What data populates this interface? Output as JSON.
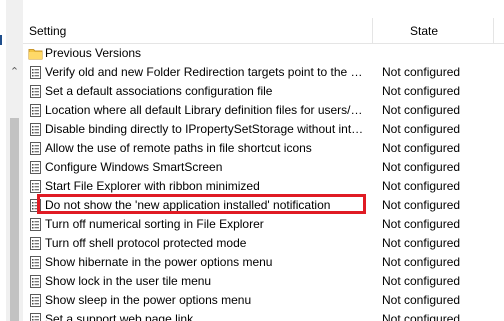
{
  "header": {
    "setting_label": "Setting",
    "state_label": "State"
  },
  "folder": {
    "label": "Previous Versions",
    "icon": "folder-icon"
  },
  "policies": [
    {
      "name": "Verify old and new Folder Redirection targets point to the sa...",
      "state": "Not configured"
    },
    {
      "name": "Set a default associations configuration file",
      "state": "Not configured"
    },
    {
      "name": "Location where all default Library definition files for users/m...",
      "state": "Not configured"
    },
    {
      "name": "Disable binding directly to IPropertySetStorage without inter...",
      "state": "Not configured"
    },
    {
      "name": "Allow the use of remote paths in file shortcut icons",
      "state": "Not configured"
    },
    {
      "name": "Configure Windows SmartScreen",
      "state": "Not configured"
    },
    {
      "name": "Start File Explorer with ribbon minimized",
      "state": "Not configured"
    },
    {
      "name": "Do not show the 'new application installed' notification",
      "state": "Not configured"
    },
    {
      "name": "Turn off numerical sorting in File Explorer",
      "state": "Not configured"
    },
    {
      "name": "Turn off shell protocol protected mode",
      "state": "Not configured"
    },
    {
      "name": "Show hibernate in the power options menu",
      "state": "Not configured"
    },
    {
      "name": "Show lock in the user tile menu",
      "state": "Not configured"
    },
    {
      "name": "Show sleep in the power options menu",
      "state": "Not configured"
    },
    {
      "name": "Set a support web page link",
      "state": "Not configured"
    }
  ],
  "policy_icon": "policy-setting-icon",
  "colors": {
    "highlight_border": "#e01b24",
    "scroll_track": "#f0f0f0",
    "scroll_thumb": "#c2c2c2",
    "folder_yellow": "#f4c542"
  }
}
